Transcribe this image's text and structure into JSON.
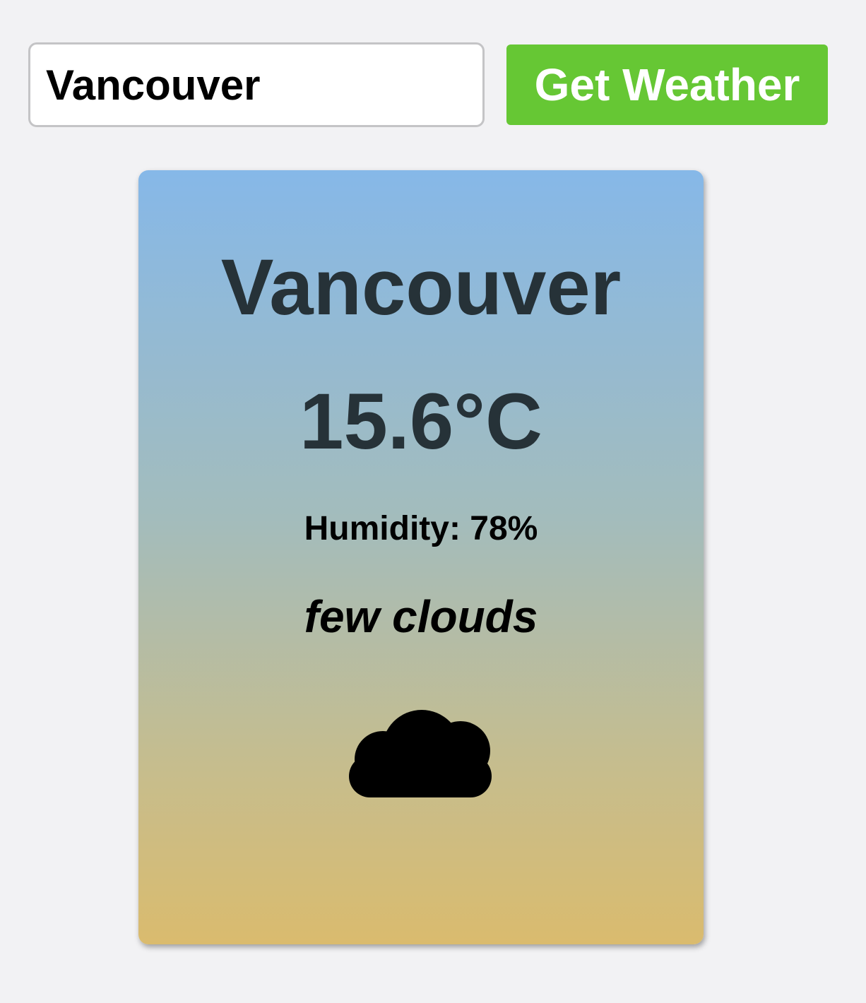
{
  "search": {
    "value": "Vancouver",
    "button_label": "Get Weather"
  },
  "weather": {
    "city": "Vancouver",
    "temperature": "15.6°C",
    "humidity": "Humidity: 78%",
    "description": "few clouds",
    "icon": "cloud-icon"
  },
  "colors": {
    "page_background": "#f2f2f4",
    "button": "#66c734",
    "card_gradient_top": "#86b8e8",
    "card_gradient_bottom": "#dabb6e",
    "heading_text": "#263238"
  }
}
